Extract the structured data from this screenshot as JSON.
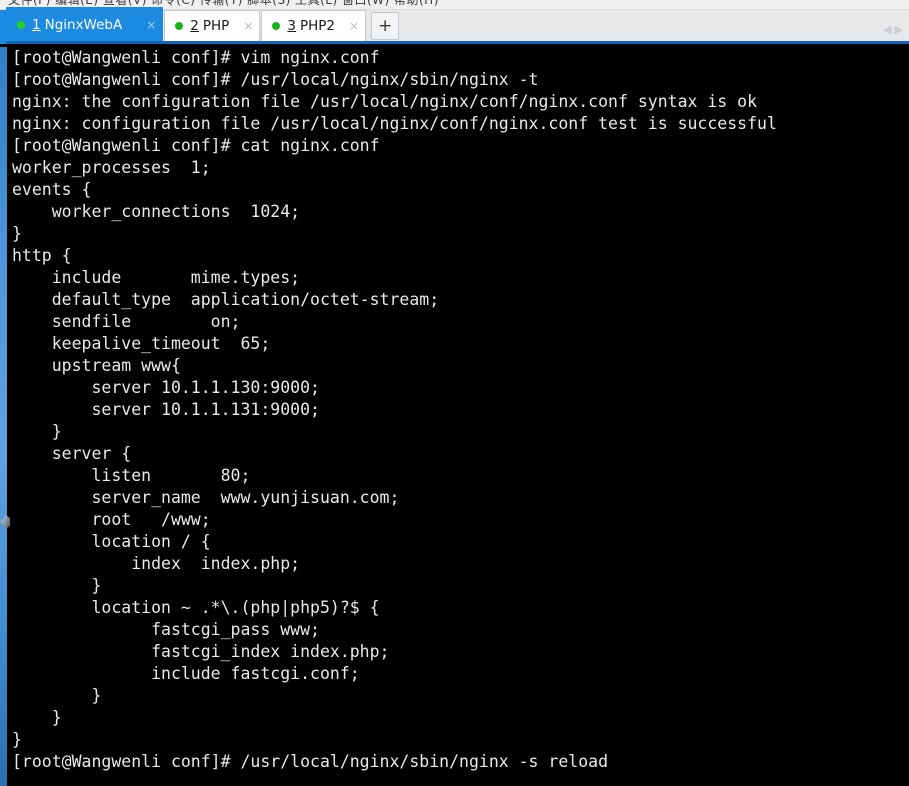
{
  "window": {
    "top_strip_text": "文件(F) 编辑(E) 查看(V) 命令(C) 传输(T) 脚本(S) 工具(L) 窗口(W) 帮助(H)"
  },
  "tabbar": {
    "new_tab_label": "+",
    "scroll_left_icon": "◀",
    "scroll_right_icon": "▶",
    "close_icon": "×",
    "active_color": "#1b8ae0",
    "connected_dot_color": "#16b41c",
    "tabs": [
      {
        "index": "1",
        "label": "NginxWebA",
        "active": true,
        "status": "connected"
      },
      {
        "index": "2",
        "label": "PHP",
        "active": false,
        "status": "connected"
      },
      {
        "index": "3",
        "label": "PHP2",
        "active": false,
        "status": "connected"
      }
    ]
  },
  "terminal": {
    "background": "#000000",
    "foreground": "#e9e9e9",
    "hostname": "Wangwenli",
    "user": "root",
    "cwd": "conf",
    "prompt": "[root@Wangwenli conf]#",
    "lines": [
      "[root@Wangwenli conf]# vim nginx.conf",
      "[root@Wangwenli conf]# /usr/local/nginx/sbin/nginx -t",
      "nginx: the configuration file /usr/local/nginx/conf/nginx.conf syntax is ok",
      "nginx: configuration file /usr/local/nginx/conf/nginx.conf test is successful",
      "[root@Wangwenli conf]# cat nginx.conf",
      "worker_processes  1;",
      "events {",
      "    worker_connections  1024;",
      "}",
      "http {",
      "    include       mime.types;",
      "    default_type  application/octet-stream;",
      "    sendfile        on;",
      "    keepalive_timeout  65;",
      "    upstream www{",
      "        server 10.1.1.130:9000;",
      "        server 10.1.1.131:9000;",
      "    }",
      "    server {",
      "        listen       80;",
      "        server_name  www.yunjisuan.com;",
      "        root   /www;",
      "        location / {",
      "            index  index.php;",
      "        }",
      "        location ~ .*\\.(php|php5)?$ {",
      "              fastcgi_pass www;",
      "              fastcgi_index index.php;",
      "              include fastcgi.conf;",
      "        }",
      "    }",
      "}",
      "[root@Wangwenli conf]# /usr/local/nginx/sbin/nginx -s reload"
    ]
  }
}
